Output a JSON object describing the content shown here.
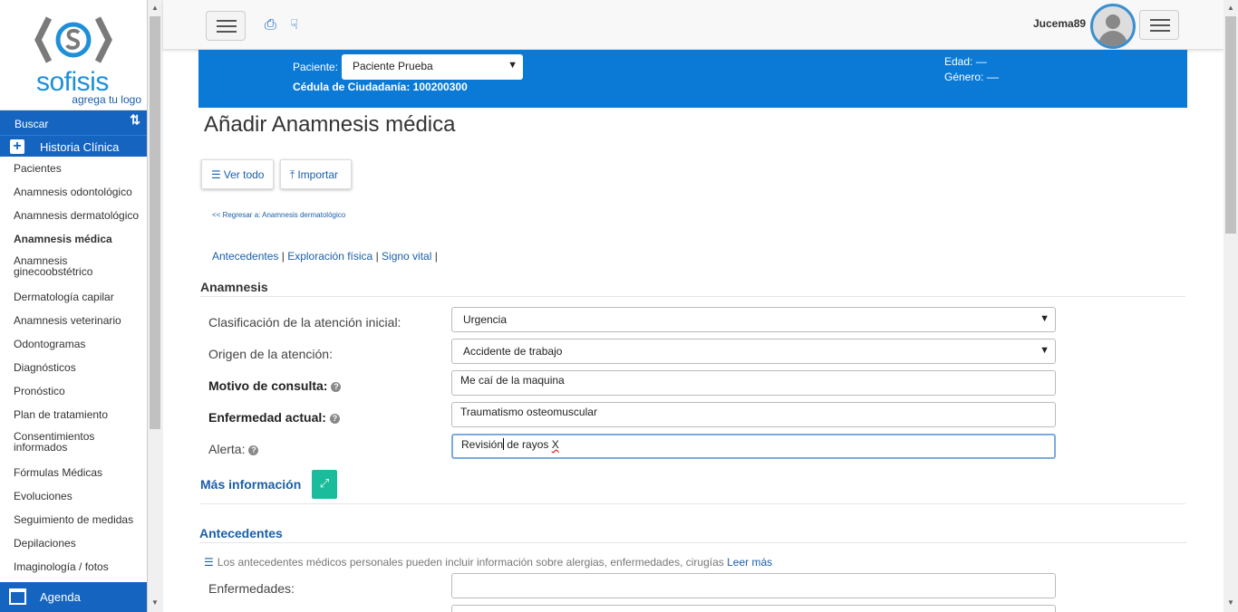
{
  "logo": {
    "name": "sofisis",
    "tagline": "agrega tu logo"
  },
  "sidebar": {
    "search_label": "Buscar",
    "search_icon": "sort-arrows-icon",
    "section_label": "Historia Clínica",
    "items": [
      {
        "label": "Pacientes"
      },
      {
        "label": "Anamnesis odontológico"
      },
      {
        "label": "Anamnesis dermatológico"
      },
      {
        "label": "Anamnesis médica",
        "active": true
      },
      {
        "label": "Anamnesis ginecoobstétrico"
      },
      {
        "label": "Dermatología capilar"
      },
      {
        "label": "Anamnesis veterinario"
      },
      {
        "label": "Odontogramas"
      },
      {
        "label": "Diagnósticos"
      },
      {
        "label": "Pronóstico"
      },
      {
        "label": "Plan de tratamiento"
      },
      {
        "label": "Consentimientos informados"
      },
      {
        "label": "Fórmulas Médicas"
      },
      {
        "label": "Evoluciones"
      },
      {
        "label": "Seguimiento de medidas"
      },
      {
        "label": "Depilaciones"
      },
      {
        "label": "Imaginología / fotos"
      }
    ],
    "agenda_label": "Agenda"
  },
  "header": {
    "username": "Jucema89"
  },
  "patient": {
    "label": "Paciente:",
    "selected": "Paciente Prueba",
    "cedula": "Cédula de Ciudadanía: 100200300",
    "edad": "Edad: —",
    "genero": "Género: ––"
  },
  "page": {
    "title": "Añadir Anamnesis médica",
    "ver_todo": "Ver todo",
    "importar": "Importar",
    "back_link": "<< Regresar a: Anamnesis dermatológico",
    "tabs": [
      "Antecedentes",
      "Exploración física",
      "Signo vital"
    ]
  },
  "anamnesis": {
    "title": "Anamnesis",
    "clasificacion_label": "Clasificación de la atención inicial:",
    "clasificacion_value": "Urgencia",
    "origen_label": "Origen de la atención:",
    "origen_value": "Accidente de trabajo",
    "motivo_label": "Motivo de consulta:",
    "motivo_value": "Me caí de la maquina",
    "enfermedad_label": "Enfermedad actual:",
    "enfermedad_value": "Traumatismo osteomuscular",
    "alerta_label": "Alerta:",
    "alerta_value_a": "Revisión",
    "alerta_value_b": " de rayos ",
    "alerta_value_c": "X"
  },
  "mas_info": "Más información",
  "antecedentes": {
    "title": "Antecedentes",
    "note": "Los antecedentes médicos personales pueden incluir información sobre alergias, enfermedades, cirugías",
    "leer_mas": "Leer más",
    "enfermedades_label": "Enfermedades:"
  },
  "colors": {
    "brand_blue": "#1565c0",
    "patient_bar": "#0a7ad6",
    "accent_teal": "#1bbc9b"
  }
}
